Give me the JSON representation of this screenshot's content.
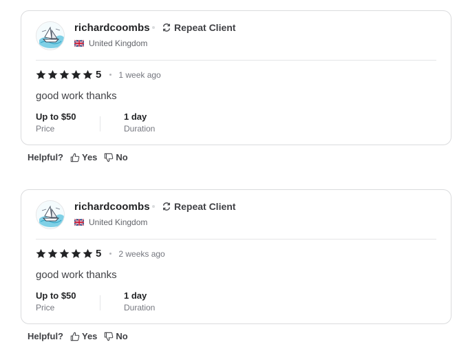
{
  "reviews": [
    {
      "username": "richardcoombs",
      "badge": "Repeat Client",
      "country": "United Kingdom",
      "rating": "5",
      "time_ago": "1 week ago",
      "text": "good work thanks",
      "price_value": "Up to $50",
      "price_label": "Price",
      "duration_value": "1 day",
      "duration_label": "Duration",
      "helpful_label": "Helpful?",
      "yes_label": "Yes",
      "no_label": "No"
    },
    {
      "username": "richardcoombs",
      "badge": "Repeat Client",
      "country": "United Kingdom",
      "rating": "5",
      "time_ago": "2 weeks ago",
      "text": "good work thanks",
      "price_value": "Up to $50",
      "price_label": "Price",
      "duration_value": "1 day",
      "duration_label": "Duration",
      "helpful_label": "Helpful?",
      "yes_label": "Yes",
      "no_label": "No"
    }
  ],
  "colors": {
    "text_primary": "#222325",
    "text_secondary": "#74767e",
    "border": "#dadbdd",
    "star": "#222325"
  },
  "icons": {
    "repeat": "repeat-client-icon",
    "flag": "uk-flag-icon",
    "star": "star-icon",
    "thumbs_up": "thumbs-up-icon",
    "thumbs_down": "thumbs-down-icon"
  }
}
